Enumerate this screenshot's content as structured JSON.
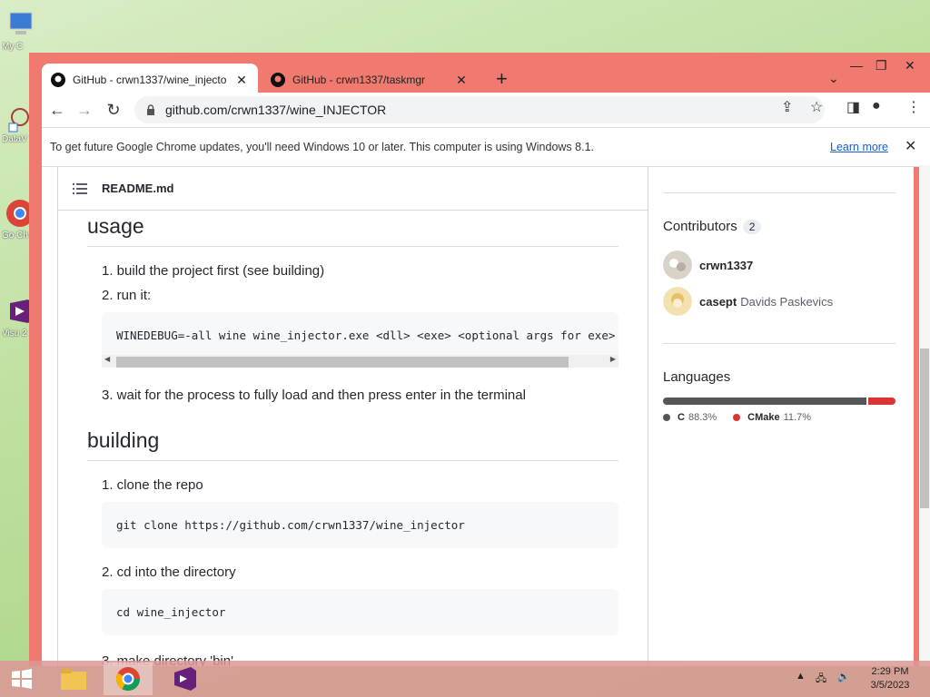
{
  "desktop": {
    "icons": [
      {
        "label": "My C"
      },
      {
        "label": "DataV"
      },
      {
        "label": "Go Ch"
      },
      {
        "label": "Visu 2"
      }
    ]
  },
  "browser": {
    "tabs": [
      {
        "title": "GitHub - crwn1337/wine_injecto",
        "active": true
      },
      {
        "title": "GitHub - crwn1337/taskmgr",
        "active": false
      }
    ],
    "url": "github.com/crwn1337/wine_INJECTOR",
    "infobar": {
      "message": "To get future Google Chrome updates, you'll need Windows 10 or later. This computer is using Windows 8.1.",
      "link": "Learn more"
    }
  },
  "readme": {
    "filename": "README.md",
    "usage": {
      "heading": "usage",
      "steps": [
        "1. build the project first (see building)",
        "2. run it:",
        "3. wait for the process to fully load and then press enter in the terminal"
      ],
      "code": "WINEDEBUG=-all wine wine_injector.exe <dll> <exe> <optional args for exe>"
    },
    "building": {
      "heading": "building",
      "steps": [
        {
          "text": "1. clone the repo",
          "code": "git clone https://github.com/crwn1337/wine_injector"
        },
        {
          "text": "2. cd into the directory",
          "code": "cd wine_injector"
        },
        {
          "text": "3. make directory 'bin'"
        }
      ]
    }
  },
  "sidebar": {
    "contributors": {
      "heading": "Contributors",
      "count": "2",
      "people": [
        {
          "login": "crwn1337",
          "name": ""
        },
        {
          "login": "casept",
          "name": "Davids Paskevics"
        }
      ]
    },
    "languages": {
      "heading": "Languages",
      "items": [
        {
          "name": "C",
          "percent": "88.3%",
          "color": "#555555",
          "value": 88.3
        },
        {
          "name": "CMake",
          "percent": "11.7%",
          "color": "#da3434",
          "value": 11.7
        }
      ]
    }
  },
  "taskbar": {
    "time": "2:29 PM",
    "date": "3/5/2023"
  }
}
